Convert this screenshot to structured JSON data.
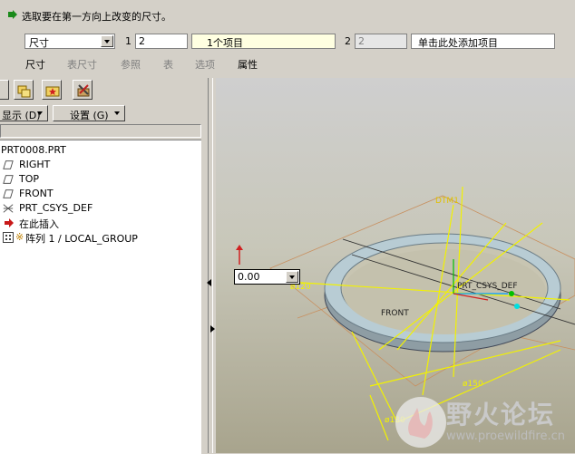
{
  "dashboard": {
    "prompt": "选取要在第一方向上改变的尺寸。",
    "dimension_type": "尺寸",
    "direction1": {
      "label": "1",
      "value": "2",
      "items": "1个项目"
    },
    "direction2": {
      "label": "2",
      "value": "2",
      "add_items": "单击此处添加项目"
    },
    "tabs": [
      {
        "label": "尺寸",
        "enabled": true
      },
      {
        "label": "表尺寸",
        "enabled": false
      },
      {
        "label": "参照",
        "enabled": false
      },
      {
        "label": "表",
        "enabled": false
      },
      {
        "label": "选项",
        "enabled": false
      },
      {
        "label": "属性",
        "enabled": true
      }
    ]
  },
  "navigator": {
    "display_button": "显示 (D)",
    "settings_button": "设置 (G)",
    "tree": [
      {
        "label": "PRT0008.PRT",
        "icon": "part-icon"
      },
      {
        "label": "RIGHT",
        "icon": "datum-plane-icon"
      },
      {
        "label": "TOP",
        "icon": "datum-plane-icon"
      },
      {
        "label": "FRONT",
        "icon": "datum-plane-icon"
      },
      {
        "label": "PRT_CSYS_DEF",
        "icon": "coordinate-system-icon"
      },
      {
        "label": "在此插入",
        "icon": "insert-here-arrow-icon"
      },
      {
        "label": "阵列 1 / LOCAL_GROUP",
        "icon": "pattern-icon"
      }
    ]
  },
  "graphics": {
    "value_input": "0.00",
    "labels": {
      "dtm": "DTM1",
      "csys": "PRT_CSYS_DEF",
      "front": "FRONT",
      "dim_left": "ø120",
      "dim_bottom": "ø150",
      "dim_bottom2": "ø130"
    }
  },
  "watermark": {
    "title": "野火论坛",
    "url": "www.proewildfire.cn"
  },
  "colors": {
    "background": "#d4d0c8",
    "highlight_field": "#ffffe1",
    "dimension": "#f2f200",
    "ring": "#8fa0a8"
  }
}
